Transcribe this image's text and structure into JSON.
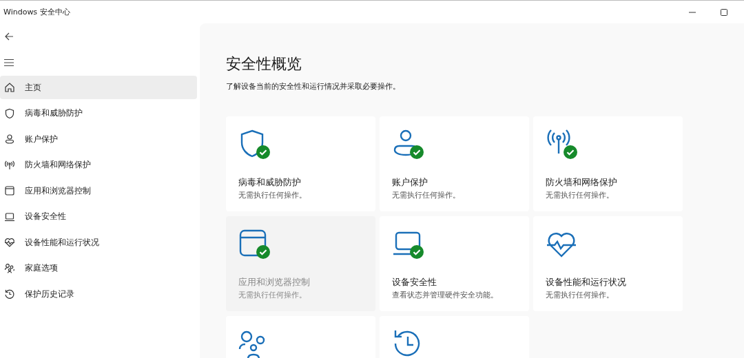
{
  "window": {
    "title": "Windows 安全中心"
  },
  "sidebar": {
    "items": [
      {
        "kind": "home",
        "label": "主页",
        "selected": true
      },
      {
        "kind": "shield",
        "label": "病毒和威胁防护",
        "selected": false
      },
      {
        "kind": "person",
        "label": "账户保护",
        "selected": false
      },
      {
        "kind": "antenna",
        "label": "防火墙和网络保护",
        "selected": false
      },
      {
        "kind": "browser",
        "label": "应用和浏览器控制",
        "selected": false
      },
      {
        "kind": "laptop",
        "label": "设备安全性",
        "selected": false
      },
      {
        "kind": "heart",
        "label": "设备性能和运行状况",
        "selected": false
      },
      {
        "kind": "family",
        "label": "家庭选项",
        "selected": false
      },
      {
        "kind": "history",
        "label": "保护历史记录",
        "selected": false
      }
    ]
  },
  "main": {
    "title": "安全性概览",
    "subtitle": "了解设备当前的安全性和运行情况并采取必要操作。",
    "cards": [
      {
        "kind": "shield",
        "title": "病毒和威胁防护",
        "status": "无需执行任何操作。",
        "ok": true,
        "highlighted": false
      },
      {
        "kind": "person",
        "title": "账户保护",
        "status": "无需执行任何操作。",
        "ok": true,
        "highlighted": false
      },
      {
        "kind": "antenna",
        "title": "防火墙和网络保护",
        "status": "无需执行任何操作。",
        "ok": true,
        "highlighted": false
      },
      {
        "kind": "browser",
        "title": "应用和浏览器控制",
        "status": "无需执行任何操作。",
        "ok": true,
        "highlighted": true
      },
      {
        "kind": "laptop",
        "title": "设备安全性",
        "status": "查看状态并管理硬件安全功能。",
        "ok": true,
        "highlighted": false
      },
      {
        "kind": "heart",
        "title": "设备性能和运行状况",
        "status": "无需执行任何操作。",
        "ok": false,
        "highlighted": false
      },
      {
        "kind": "family",
        "highlighted": false
      },
      {
        "kind": "history",
        "highlighted": false
      }
    ]
  }
}
